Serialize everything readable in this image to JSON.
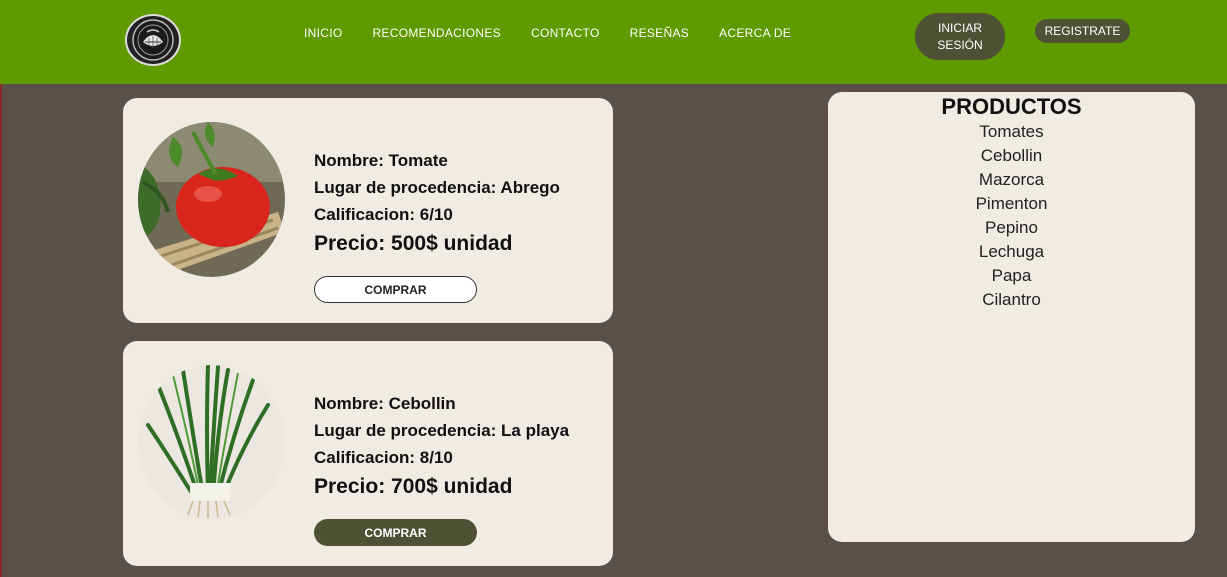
{
  "nav": {
    "links": [
      "INICIO",
      "RECOMENDACIONES",
      "CONTACTO",
      "RESEÑAS",
      "ACERCA DE"
    ],
    "login_label": "INICIAR SESIÓN",
    "register_label": "REGISTRATE",
    "logo_icon": "farm-emblem-logo",
    "color": "#5e9a00"
  },
  "products": [
    {
      "name": "Nombre: Tomate",
      "origin": "Lugar de procedencia: Abrego",
      "rating": "Calificacion: 6/10",
      "price": "Precio: 500$ unidad",
      "buy_label": "COMPRAR",
      "image": "tomato-image"
    },
    {
      "name": "Nombre: Cebollin",
      "origin": "Lugar de procedencia: La playa",
      "rating": "Calificacion: 8/10",
      "price": "Precio: 700$ unidad",
      "buy_label": "COMPRAR",
      "image": "spring-onion-image"
    }
  ],
  "sidebar": {
    "title": "PRODUCTOS",
    "items": [
      "Tomates",
      "Cebollin",
      "Mazorca",
      "Pimenton",
      "Pepino",
      "Lechuga",
      "Papa",
      "Cilantro"
    ]
  },
  "colors": {
    "background": "#5a5049",
    "card": "#f0ebe3",
    "button_dark": "#4e5235"
  }
}
